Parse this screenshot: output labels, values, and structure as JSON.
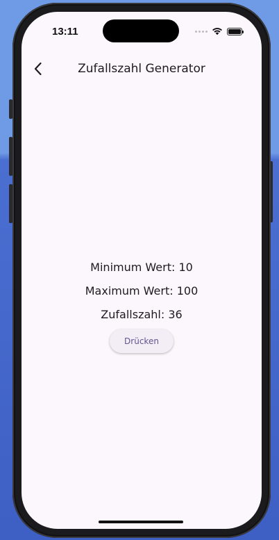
{
  "status_bar": {
    "time": "13:11",
    "wifi_icon": "wifi-icon",
    "battery_icon": "battery-icon"
  },
  "app_bar": {
    "back_icon": "chevron-left-icon",
    "title": "Zufallszahl Generator"
  },
  "main": {
    "minimum_text": "Minimum Wert: 10",
    "maximum_text": "Maximum Wert: 100",
    "random_text": "Zufallszahl: 36",
    "button_label": "Drücken"
  },
  "colors": {
    "screen_background": "#fcf7fc",
    "button_background": "#f3edf6",
    "button_text": "#65558f",
    "text": "#1d1b20"
  }
}
